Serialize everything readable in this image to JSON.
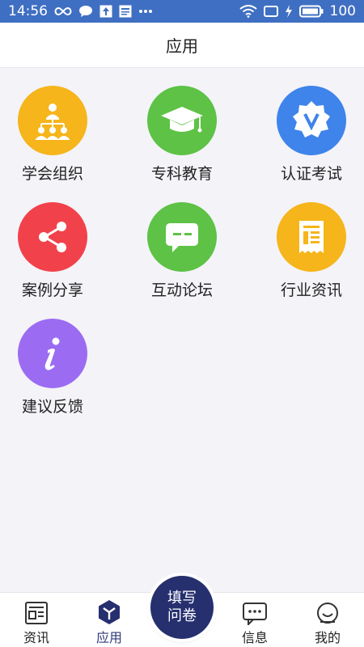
{
  "status": {
    "time": "14:56",
    "battery": "100",
    "icons_left": [
      "infinity-icon",
      "chat-bubble-icon",
      "upload-icon",
      "news-icon",
      "more-dots-icon"
    ],
    "icons_right": [
      "wifi-icon",
      "screen-icon",
      "charging-icon",
      "battery-icon"
    ]
  },
  "header": {
    "title": "应用"
  },
  "apps": [
    {
      "label": "学会组织",
      "icon": "organization-icon",
      "color": "#f5b51b"
    },
    {
      "label": "专科教育",
      "icon": "graduation-cap-icon",
      "color": "#5dc245"
    },
    {
      "label": "认证考试",
      "icon": "verified-badge-icon",
      "color": "#3e84ea"
    },
    {
      "label": "案例分享",
      "icon": "share-icon",
      "color": "#f1424b"
    },
    {
      "label": "互动论坛",
      "icon": "forum-chat-icon",
      "color": "#5dc245"
    },
    {
      "label": "行业资讯",
      "icon": "news-document-icon",
      "color": "#f5b51b"
    },
    {
      "label": "建议反馈",
      "icon": "info-icon",
      "color": "#9b6cf2"
    }
  ],
  "tabbar": {
    "tabs": [
      {
        "label": "资讯",
        "icon": "news-tab-icon",
        "active": false
      },
      {
        "label": "应用",
        "icon": "apps-cube-icon",
        "active": true
      },
      {
        "label": "信息",
        "icon": "message-tab-icon",
        "active": false
      },
      {
        "label": "我的",
        "icon": "profile-tab-icon",
        "active": false
      }
    ],
    "fab_line1": "填写",
    "fab_line2": "问卷"
  },
  "colors": {
    "status_bar": "#3f6fc2",
    "accent_dark": "#26306f"
  }
}
